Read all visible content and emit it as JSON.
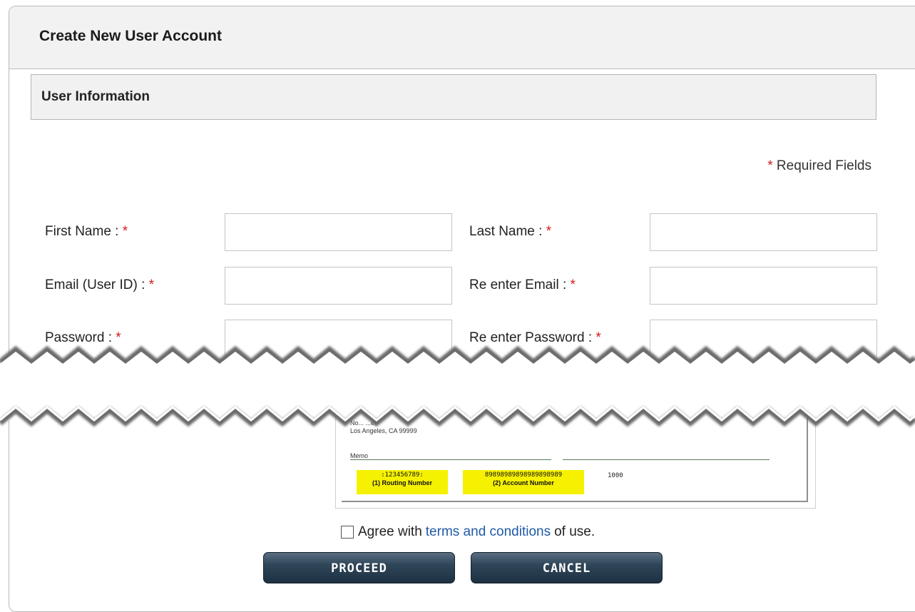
{
  "header": {
    "title": "Create New User Account"
  },
  "section": {
    "title": "User Information"
  },
  "required_note": {
    "star": "*",
    "text": "Required Fields"
  },
  "form": {
    "first_name": {
      "label": "First Name :",
      "value": ""
    },
    "last_name": {
      "label": "Last Name :",
      "value": ""
    },
    "email": {
      "label": "Email (User ID) :",
      "value": ""
    },
    "reenter_email": {
      "label": "Re enter Email :",
      "value": ""
    },
    "password": {
      "label": "Password :",
      "value": ""
    },
    "reenter_password": {
      "label": "Re enter Password :",
      "value": ""
    },
    "required_star": "*"
  },
  "check_sample": {
    "address_line1": "No... ...et",
    "address_line2": "Los Angeles, CA 99999",
    "memo": "Memo",
    "routing_micr": ":123456789:",
    "routing_label": "(1) Routing Number",
    "account_micr": "89898989898989898989",
    "account_label": "(2) Account Number",
    "check_number": "1000"
  },
  "agree": {
    "prefix": "Agree with",
    "link": "terms and conditions",
    "suffix": "of use.",
    "checked": false
  },
  "buttons": {
    "proceed": "PROCEED",
    "cancel": "CANCEL"
  },
  "colors": {
    "required_star": "#d11a1a",
    "link": "#1f5aa6",
    "button": "#2f4558",
    "highlight": "#f5f100"
  }
}
